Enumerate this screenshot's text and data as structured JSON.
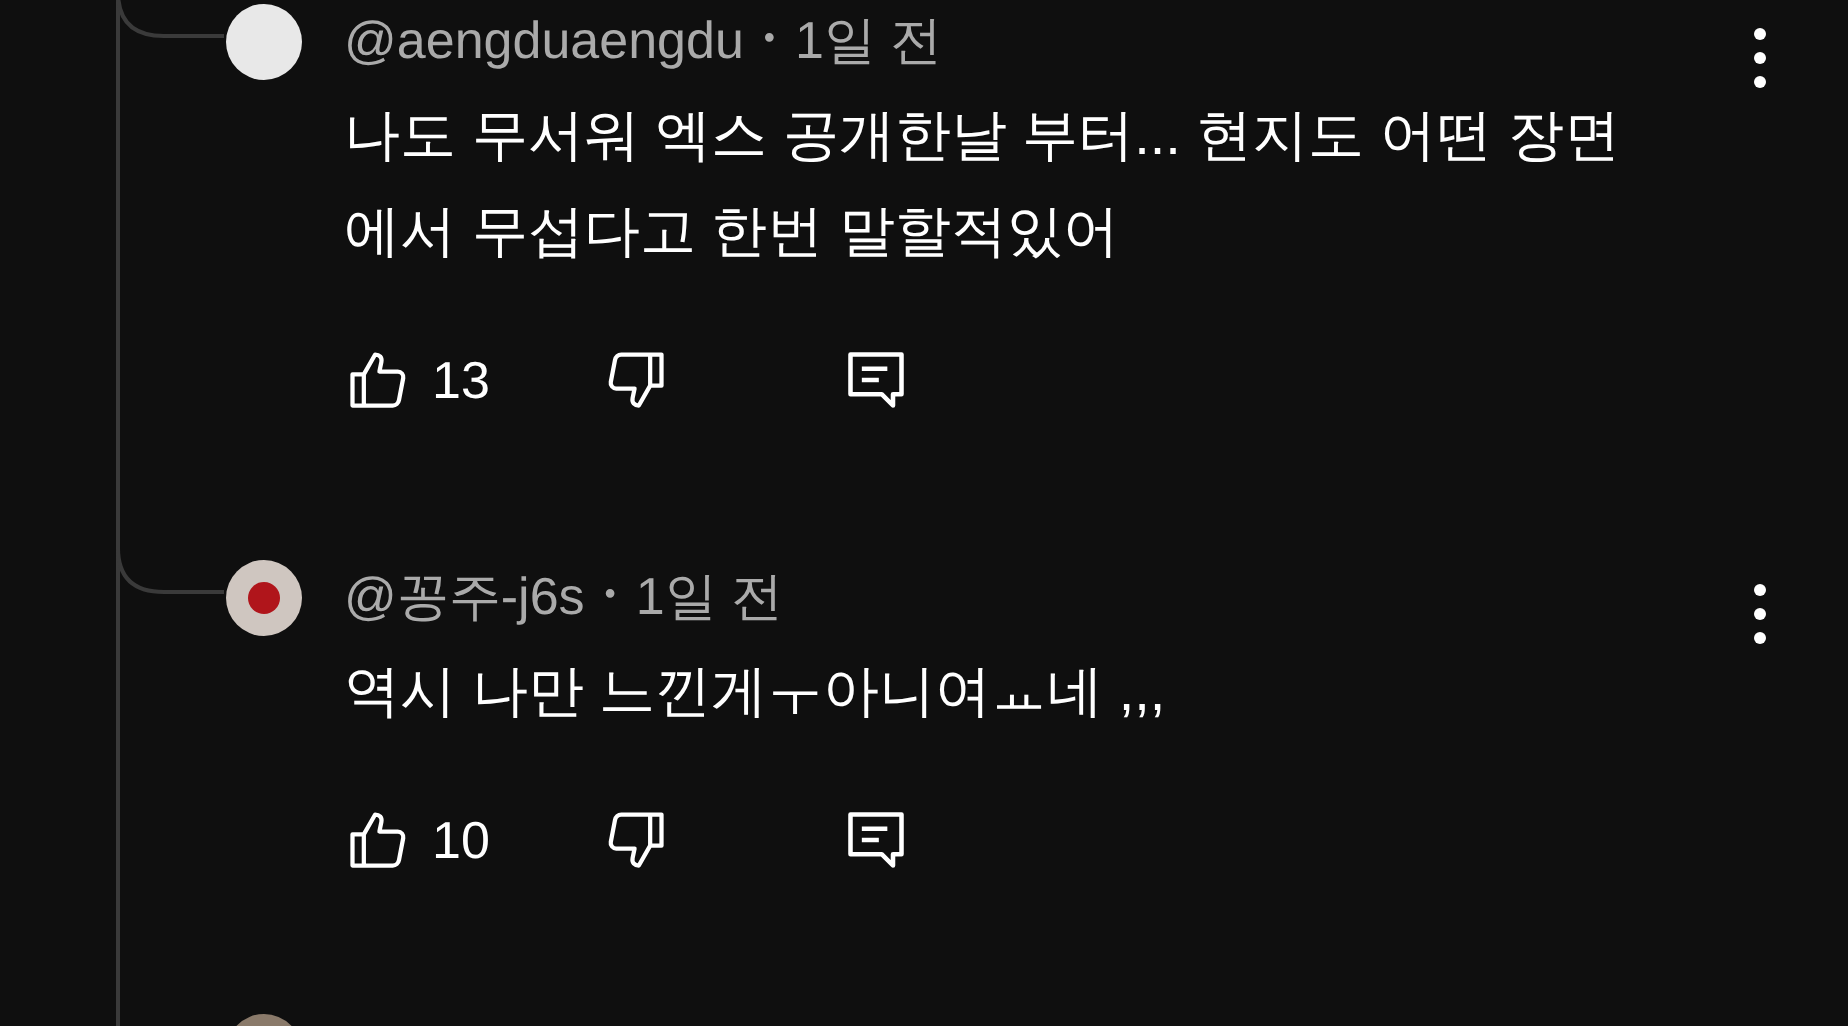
{
  "comments": [
    {
      "author": "@aengduaengdu",
      "separator": "•",
      "time": "1일 전",
      "lines": [
        "나도 무서워 엑스 공개한날 부터... 현지도 어떤 장면",
        "에서 무섭다고 한번 말할적있어"
      ],
      "likes": "13"
    },
    {
      "author": "@꽁주-j6s",
      "separator": "•",
      "time": "1일 전",
      "lines": [
        "역시 나만 느낀게ㅜ아니여ㅛ네 ,,,"
      ],
      "likes": "10"
    }
  ]
}
